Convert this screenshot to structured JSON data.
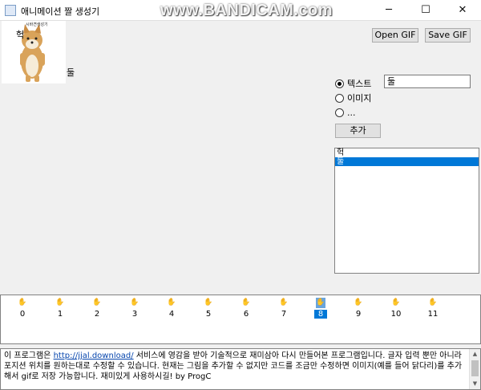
{
  "window": {
    "title": "애니메이션 짤 생성기",
    "watermark": "www.BANDICAM.com",
    "minimize_glyph": "─",
    "maximize_glyph": "☐",
    "close_glyph": "✕"
  },
  "canvas": {
    "image_caption": "시바견생성기",
    "overlay_texts": [
      "헉",
      "둘"
    ]
  },
  "toolbar": {
    "open_label": "Open GIF",
    "save_label": "Save GIF"
  },
  "options": {
    "radios": [
      {
        "label": "텍스트",
        "checked": true
      },
      {
        "label": "이미지",
        "checked": false
      },
      {
        "label": "...",
        "checked": false
      }
    ],
    "text_value": "둘",
    "add_label": "추가"
  },
  "layers": {
    "items": [
      "헉",
      "둘"
    ],
    "selected_index": 1
  },
  "frames": {
    "numbers": [
      "0",
      "1",
      "2",
      "3",
      "4",
      "5",
      "6",
      "7",
      "8",
      "9",
      "10",
      "11"
    ],
    "selected_index": 8
  },
  "description": {
    "prefix": "이 프로그램은 ",
    "link": "http://jjal.download/",
    "suffix": " 서비스에 영감을 받아 기술적으로 재미삼아 다시 만들어본 프로그램입니다. 글자 입력 뿐만 아니라 포지션 위치를 원하는대로 수정할 수 있습니다. 현재는 그림을 추가할 수 없지만 코드를 조금만 수정하면 이미지(예를 들어 닭다리)를 추가해서 gif로 저장 가능합니다. 재미있게 사용하시길! by ProgC"
  }
}
